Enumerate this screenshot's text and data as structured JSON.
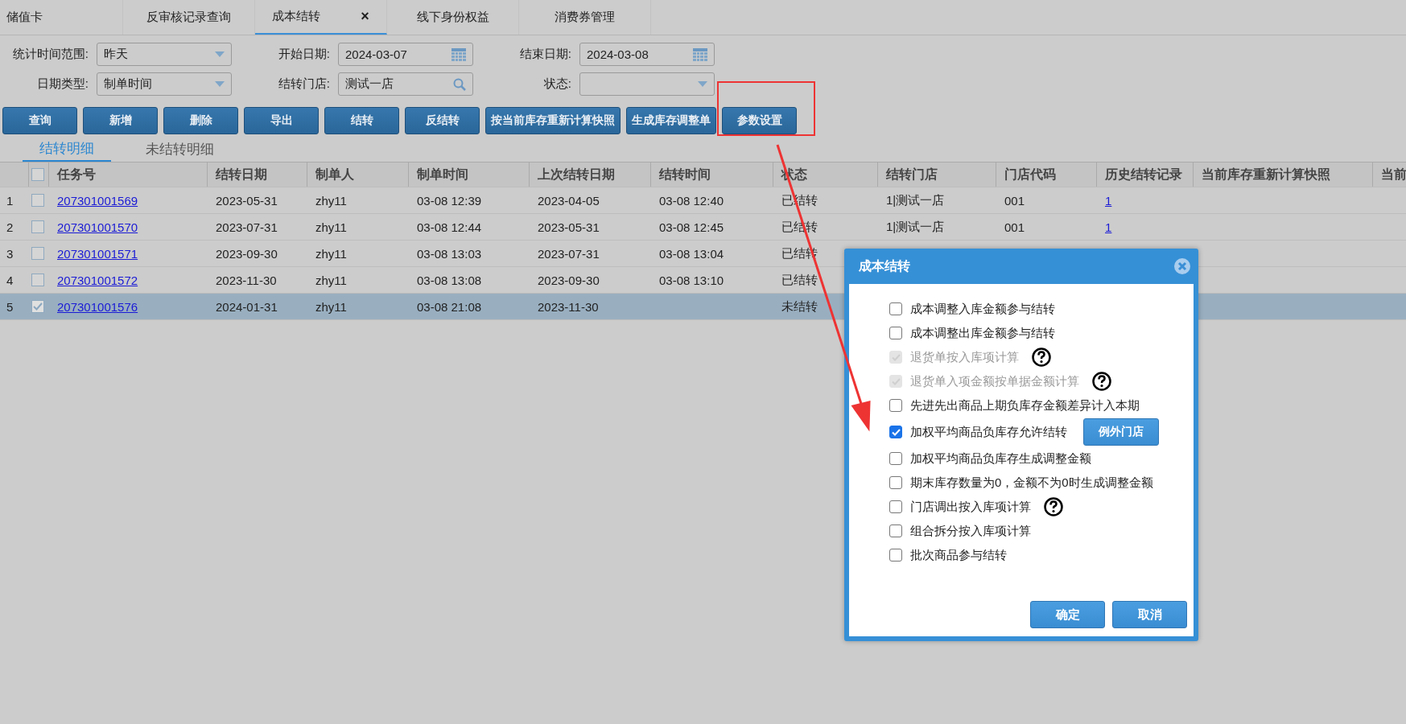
{
  "tabs": [
    {
      "label": "储值卡",
      "selected": false
    },
    {
      "label": "反审核记录查询",
      "selected": false
    },
    {
      "label": "成本结转",
      "selected": true,
      "close_glyph": "×"
    },
    {
      "label": "线下身份权益",
      "selected": false
    },
    {
      "label": "消费券管理",
      "selected": false
    }
  ],
  "filters": [
    [
      {
        "label": "统计时间范围:",
        "kind": "select",
        "value": "昨天"
      },
      {
        "label": "开始日期:",
        "kind": "date",
        "value": "2024-03-07"
      },
      {
        "label": "结束日期:",
        "kind": "date",
        "value": "2024-03-08"
      }
    ],
    [
      {
        "label": "日期类型:",
        "kind": "select",
        "value": "制单时间"
      },
      {
        "label": "结转门店:",
        "kind": "search",
        "value": "测试一店"
      },
      {
        "label": "状态:",
        "kind": "select"
      }
    ]
  ],
  "buttons": [
    {
      "label": "查询",
      "annotated": false
    },
    {
      "label": "新增",
      "annotated": false
    },
    {
      "label": "删除",
      "annotated": false
    },
    {
      "label": "导出",
      "annotated": false
    },
    {
      "label": "结转",
      "annotated": false
    },
    {
      "label": "反结转",
      "annotated": false
    },
    {
      "label": "按当前库存重新计算快照",
      "annotated": false
    },
    {
      "label": "生成库存调整单",
      "annotated": false
    },
    {
      "label": "参数设置",
      "annotated": true
    }
  ],
  "subtabs": [
    {
      "label": "结转明细",
      "selected": true
    },
    {
      "label": "未结转明细",
      "selected": false
    }
  ],
  "table": {
    "header_checked": false,
    "columns": [
      {
        "label": "任务号",
        "kind": "link"
      },
      {
        "label": "结转日期",
        "kind": "text"
      },
      {
        "label": "制单人",
        "kind": "text"
      },
      {
        "label": "制单时间",
        "kind": "text"
      },
      {
        "label": "上次结转日期",
        "kind": "text"
      },
      {
        "label": "结转时间",
        "kind": "text"
      },
      {
        "label": "状态",
        "kind": "text"
      },
      {
        "label": "结转门店",
        "kind": "text"
      },
      {
        "label": "门店代码",
        "kind": "text"
      },
      {
        "label": "历史结转记录",
        "kind": "link"
      },
      {
        "label": "当前库存重新计算快照"
      },
      {
        "label": "当前"
      }
    ],
    "rows": [
      {
        "index": "1",
        "checked": false,
        "selected": false,
        "cells": [
          "207301001569",
          "2023-05-31",
          "zhy11",
          "03-08 12:39",
          "2023-04-05",
          "03-08 12:40",
          "已结转",
          "1|测试一店",
          "001",
          "1",
          null,
          null
        ]
      },
      {
        "index": "2",
        "checked": false,
        "selected": false,
        "cells": [
          "207301001570",
          "2023-07-31",
          "zhy11",
          "03-08 12:44",
          "2023-05-31",
          "03-08 12:45",
          "已结转",
          "1|测试一店",
          "001",
          "1",
          null,
          null
        ]
      },
      {
        "index": "3",
        "checked": false,
        "selected": false,
        "cells": [
          "207301001571",
          "2023-09-30",
          "zhy11",
          "03-08 13:03",
          "2023-07-31",
          "03-08 13:04",
          "已结转",
          null,
          null,
          null,
          null,
          null
        ]
      },
      {
        "index": "4",
        "checked": false,
        "selected": false,
        "cells": [
          "207301001572",
          "2023-11-30",
          "zhy11",
          "03-08 13:08",
          "2023-09-30",
          "03-08 13:10",
          "已结转",
          null,
          null,
          null,
          null,
          null
        ]
      },
      {
        "index": "5",
        "checked": true,
        "selected": true,
        "cells": [
          "207301001576",
          "2024-01-31",
          "zhy11",
          "03-08 21:08",
          "2023-11-30",
          null,
          "未结转",
          null,
          null,
          null,
          null,
          null
        ]
      }
    ]
  },
  "dialog": {
    "title": "成本结转",
    "options": [
      {
        "label": "成本调整入库金额参与结转",
        "checked": false,
        "disabled": false
      },
      {
        "label": "成本调整出库金额参与结转",
        "checked": false,
        "disabled": false
      },
      {
        "label": "退货单按入库项计算",
        "checked": true,
        "disabled": true,
        "help": true
      },
      {
        "label": "退货单入项金额按单据金额计算",
        "checked": true,
        "disabled": true,
        "help": true
      },
      {
        "label": "先进先出商品上期负库存金额差异计入本期",
        "checked": false,
        "disabled": false
      },
      {
        "label": "加权平均商品负库存允许结转",
        "checked": true,
        "disabled": false,
        "button": "例外门店"
      },
      {
        "label": "加权平均商品负库存生成调整金额",
        "checked": false,
        "disabled": false
      },
      {
        "label": "期末库存数量为0，金额不为0时生成调整金额",
        "checked": false,
        "disabled": false
      },
      {
        "label": "门店调出按入库项计算",
        "checked": false,
        "disabled": false,
        "help": true
      },
      {
        "label": "组合拆分按入库项计算",
        "checked": false,
        "disabled": false
      },
      {
        "label": "批次商品参与结转",
        "checked": false,
        "disabled": false
      }
    ],
    "buttons": [
      "确定",
      "取消"
    ]
  }
}
